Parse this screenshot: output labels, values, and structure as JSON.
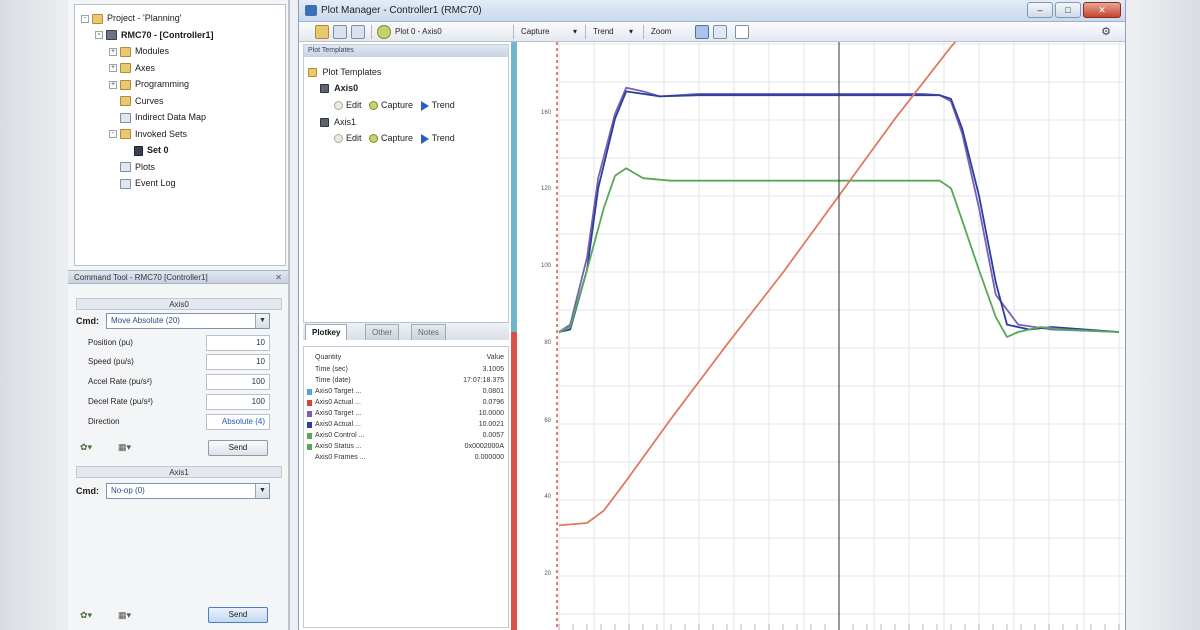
{
  "left_panel": {
    "tree": [
      {
        "label": "Project - 'Planning'",
        "level": 0,
        "expander": "-",
        "icon": "folder",
        "bold": false
      },
      {
        "label": "RMC70 - [Controller1]",
        "level": 1,
        "expander": "-",
        "icon": "device",
        "bold": true
      },
      {
        "label": "Modules",
        "level": 2,
        "expander": "+",
        "icon": "folder",
        "bold": false
      },
      {
        "label": "Axes",
        "level": 2,
        "expander": "+",
        "icon": "folder",
        "bold": false
      },
      {
        "label": "Programming",
        "level": 2,
        "expander": "+",
        "icon": "folder",
        "bold": false
      },
      {
        "label": "Curves",
        "level": 2,
        "expander": "",
        "icon": "folder",
        "bold": false
      },
      {
        "label": "Indirect Data Map",
        "level": 2,
        "expander": "",
        "icon": "doc",
        "bold": false
      },
      {
        "label": "Invoked Sets",
        "level": 2,
        "expander": "-",
        "icon": "folder",
        "bold": false
      },
      {
        "label": "Set 0",
        "level": 3,
        "expander": "",
        "icon": "axis",
        "bold": true
      },
      {
        "label": "Plots",
        "level": 2,
        "expander": "",
        "icon": "doc",
        "bold": false
      },
      {
        "label": "Event Log",
        "level": 2,
        "expander": "",
        "icon": "doc",
        "bold": false
      }
    ],
    "panel_header": "Command Tool - RMC70 [Controller1]",
    "axis0": {
      "header": "Axis0",
      "cmd_label": "Cmd:",
      "cmd_value": "Move Absolute (20)",
      "params": [
        {
          "label": "Position (pu)",
          "value": "10"
        },
        {
          "label": "Speed (pu/s)",
          "value": "10"
        },
        {
          "label": "Accel Rate (pu/s²)",
          "value": "100"
        },
        {
          "label": "Decel Rate (pu/s²)",
          "value": "100"
        },
        {
          "label": "Direction",
          "value": "Absolute (4)"
        }
      ],
      "send_label": "Send"
    },
    "axis1": {
      "header": "Axis1",
      "cmd_label": "Cmd:",
      "cmd_value": "No-op (0)",
      "send_label": "Send"
    }
  },
  "window": {
    "title": "Plot Manager - Controller1 (RMC70)",
    "buttons": {
      "minimize": "–",
      "maximize": "□",
      "close": "✕"
    },
    "toolbar": {
      "plot_label": "Plot 0 - Axis0",
      "capture_label": "Capture",
      "trend_label": "Trend",
      "zoom_label": "Zoom"
    }
  },
  "templates": {
    "header": "Plot Templates",
    "root": "Plot Templates",
    "items": [
      {
        "name": "Axis0",
        "edit": "Edit",
        "capture": "Capture",
        "trend": "Trend"
      },
      {
        "name": "Axis1",
        "edit": "Edit",
        "capture": "Capture",
        "trend": "Trend"
      }
    ]
  },
  "tabs": [
    "Plotkey",
    "Other",
    "Notes"
  ],
  "table": {
    "header": {
      "name": "Quantity",
      "value": "Value"
    },
    "rows": [
      {
        "color": "",
        "name": "Time (sec)",
        "value": "3.1005"
      },
      {
        "color": "",
        "name": "Time (date)",
        "value": "17:07:18.375"
      },
      {
        "color": "#55a0d8",
        "name": "Axis0 Target ...",
        "value": "0.0801"
      },
      {
        "color": "#d0453a",
        "name": "Axis0 Actual ...",
        "value": "0.0796"
      },
      {
        "color": "#7b5fb8",
        "name": "Axis0 Target ...",
        "value": "10.0000"
      },
      {
        "color": "#2c3f9c",
        "name": "Axis0 Actual ...",
        "value": "10.0021"
      },
      {
        "color": "#58a858",
        "name": "Axis0 Control ...",
        "value": "0.0057"
      },
      {
        "color": "#58a858",
        "name": "Axis0 Status ...",
        "value": "0x0002000A"
      },
      {
        "color": "",
        "name": "Axis0 Frames ...",
        "value": "0.000000"
      }
    ]
  },
  "chart_data": {
    "type": "line",
    "y_tick_labels": [
      "160",
      "120",
      "100",
      "80",
      "60",
      "40",
      "20"
    ],
    "cursor_x_fraction": 0.5,
    "series": [
      {
        "color": "#7b5fb8",
        "x": [
          0,
          0.02,
          0.05,
          0.07,
          0.1,
          0.12,
          0.15,
          0.18,
          0.25,
          0.4,
          0.55,
          0.65,
          0.68,
          0.7,
          0.72,
          0.75,
          0.78,
          0.82,
          0.88,
          1.0
        ],
        "y": [
          0.0,
          0.03,
          0.3,
          0.62,
          0.88,
          0.985,
          0.97,
          0.95,
          0.96,
          0.96,
          0.96,
          0.96,
          0.955,
          0.93,
          0.8,
          0.5,
          0.15,
          0.03,
          0.01,
          0.0
        ]
      },
      {
        "color": "#2c3f9c",
        "x": [
          0,
          0.02,
          0.05,
          0.07,
          0.1,
          0.12,
          0.15,
          0.18,
          0.25,
          0.4,
          0.55,
          0.65,
          0.68,
          0.7,
          0.72,
          0.75,
          0.78,
          0.8,
          0.84,
          0.88,
          1.0
        ],
        "y": [
          0.0,
          0.01,
          0.25,
          0.58,
          0.86,
          0.97,
          0.96,
          0.95,
          0.955,
          0.955,
          0.955,
          0.955,
          0.955,
          0.94,
          0.82,
          0.55,
          0.2,
          0.03,
          0.01,
          0.02,
          0.0
        ]
      },
      {
        "color": "#58a858",
        "x": [
          0,
          0.02,
          0.05,
          0.08,
          0.1,
          0.12,
          0.15,
          0.2,
          0.3,
          0.5,
          0.65,
          0.68,
          0.7,
          0.72,
          0.75,
          0.78,
          0.8,
          0.82,
          0.86,
          0.9,
          1.0
        ],
        "y": [
          0.0,
          0.02,
          0.25,
          0.5,
          0.63,
          0.66,
          0.62,
          0.61,
          0.61,
          0.61,
          0.61,
          0.61,
          0.58,
          0.45,
          0.25,
          0.06,
          -0.02,
          0.0,
          0.02,
          0.01,
          0.0
        ]
      },
      {
        "color": "#e07a5f",
        "x": [
          0,
          0.05,
          0.08,
          0.12,
          0.2,
          0.3,
          0.4,
          0.5,
          0.6,
          0.7,
          0.75,
          0.78,
          0.8,
          0.85,
          0.9,
          1.0
        ],
        "y": [
          -0.78,
          -0.77,
          -0.72,
          -0.6,
          -0.35,
          -0.05,
          0.24,
          0.55,
          0.86,
          1.15,
          1.28,
          1.33,
          1.34,
          1.36,
          1.37,
          1.37
        ]
      }
    ]
  }
}
